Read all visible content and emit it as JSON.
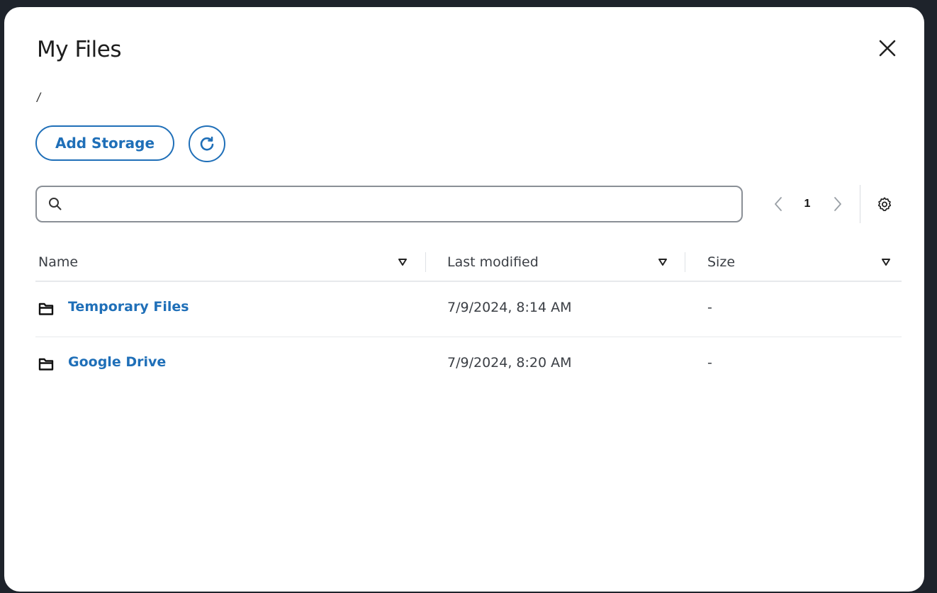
{
  "dialog": {
    "title": "My Files",
    "close_icon": "close-icon"
  },
  "breadcrumb": "/",
  "toolbar": {
    "add_storage_label": "Add Storage",
    "refresh_icon": "refresh-icon"
  },
  "search": {
    "value": "",
    "placeholder": "",
    "icon": "search-icon"
  },
  "pagination": {
    "current_page": "1",
    "prev_icon": "chevron-left-icon",
    "next_icon": "chevron-right-icon",
    "settings_icon": "gear-icon"
  },
  "table": {
    "columns": [
      {
        "label": "Name"
      },
      {
        "label": "Last modified"
      },
      {
        "label": "Size"
      }
    ],
    "rows": [
      {
        "icon": "folder-icon",
        "name": "Temporary Files",
        "modified": "7/9/2024, 8:14 AM",
        "size": "-"
      },
      {
        "icon": "folder-icon",
        "name": "Google Drive",
        "modified": "7/9/2024, 8:20 AM",
        "size": "-"
      }
    ]
  },
  "colors": {
    "accent": "#1f6fb8",
    "backdrop": "#1e232b"
  }
}
